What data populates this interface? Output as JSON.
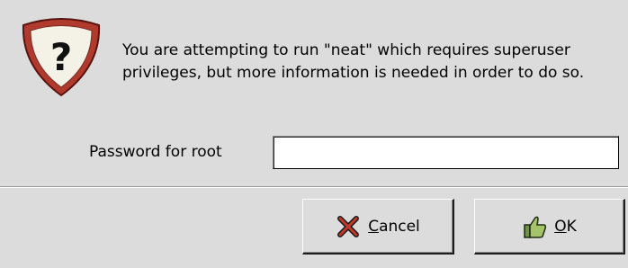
{
  "dialog": {
    "message_line1": "You are attempting to run \"neat\" which requires superuser",
    "message_line2": "privileges, but more information is needed in order to do so.",
    "icon": "question-shield-icon",
    "accent_color": "#c0392b"
  },
  "password": {
    "label": "Password for root",
    "value": ""
  },
  "buttons": {
    "cancel": {
      "mnemonic": "C",
      "rest": "ancel",
      "icon": "cross-icon"
    },
    "ok": {
      "mnemonic": "O",
      "rest": "K",
      "icon": "thumb-hand-icon"
    }
  }
}
